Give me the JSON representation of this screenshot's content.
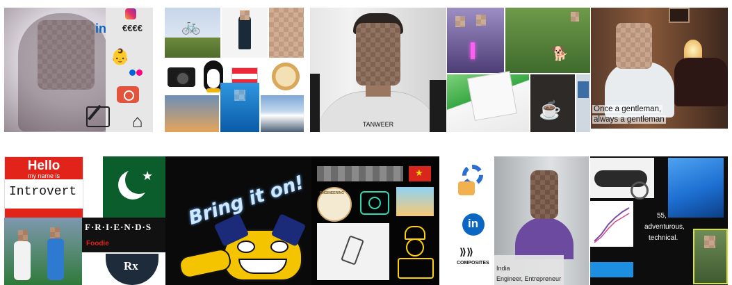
{
  "tiles": {
    "t1": {
      "icons": [
        "instagram-icon",
        "linkedin-icon",
        "euro-icon",
        "baby-icon",
        "flickr-icon",
        "camera-icon",
        "signature-icon",
        "home-icon"
      ],
      "euro_text": "€€€€",
      "linkedin_text": "in"
    },
    "t2": {
      "icons": [
        "linux-penguin-icon",
        "camera-icon",
        "austria-flag-icon",
        "noodle-bowl-icon",
        "bike-icon"
      ]
    },
    "t3": {
      "caption": "TANWEER"
    },
    "t4": {
      "icons": [
        "laptop-icon",
        "coffee-cup-icon",
        "dog-icon"
      ]
    },
    "t5": {
      "caption_line1": "Once a gentleman,",
      "caption_line2": "always a gentleman"
    },
    "t6": {
      "hello": "Hello",
      "my_name_is": "my name is",
      "name": "Introvert",
      "friends": "F·R·I·E·N·D·S",
      "foodie": "Foodie",
      "rx": "Rx"
    },
    "t7": {
      "slogan": "Bring it on!"
    },
    "t8": {
      "engineering": "ENGINEERING",
      "icons": [
        "vietnam-flag-icon",
        "camera-icon",
        "chef-icon",
        "engineering-badge-icon"
      ]
    },
    "t9": {
      "linkedin_text": "in",
      "composites": "COMPOSITES",
      "country": "India",
      "role": "Engineer, Entrepreneur"
    },
    "t10": {
      "text_line1": "55,",
      "text_line2": "adventurous,",
      "text_line3": "technical."
    }
  },
  "colors": {
    "linkedin": "#0a66c2",
    "pakistan_green": "#0b5e2b",
    "hello_red": "#e2231a",
    "vietnam_red": "#da251d",
    "austria_red": "#ed2939",
    "windows_blue": "#1d6fd2"
  }
}
